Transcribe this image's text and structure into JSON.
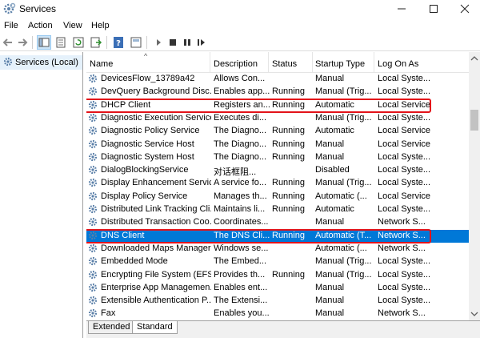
{
  "window": {
    "title": "Services",
    "icon": "gear-icon",
    "controls": [
      "minimize-icon",
      "maximize-icon",
      "close-icon"
    ]
  },
  "menu": [
    {
      "label": "File",
      "accel": "F"
    },
    {
      "label": "Action",
      "accel": "A"
    },
    {
      "label": "View",
      "accel": "V"
    },
    {
      "label": "Help",
      "accel": "H"
    }
  ],
  "toolbar": {
    "icons": [
      "back-icon",
      "forward-icon",
      "console-tree-icon",
      "properties-icon",
      "refresh-icon",
      "export-icon",
      "help-icon",
      "show-hide-icon",
      "start-icon",
      "stop-icon",
      "pause-icon",
      "restart-icon"
    ]
  },
  "tree": {
    "root_label": "Services (Local)"
  },
  "table": {
    "columns": [
      "Name",
      "Description",
      "Status",
      "Startup Type",
      "Log On As"
    ],
    "sorted_column": "Name",
    "rows": [
      {
        "name": "DevicesFlow_13789a42",
        "description": "Allows Con...",
        "status": "",
        "startup": "Manual",
        "logon": "Local Syste..."
      },
      {
        "name": "DevQuery Background Disc...",
        "description": "Enables app...",
        "status": "Running",
        "startup": "Manual (Trig...",
        "logon": "Local Syste..."
      },
      {
        "name": "DHCP Client",
        "description": "Registers an...",
        "status": "Running",
        "startup": "Automatic",
        "logon": "Local Service"
      },
      {
        "name": "Diagnostic Execution Service",
        "description": "Executes di...",
        "status": "",
        "startup": "Manual (Trig...",
        "logon": "Local Syste..."
      },
      {
        "name": "Diagnostic Policy Service",
        "description": "The Diagno...",
        "status": "Running",
        "startup": "Automatic",
        "logon": "Local Service"
      },
      {
        "name": "Diagnostic Service Host",
        "description": "The Diagno...",
        "status": "Running",
        "startup": "Manual",
        "logon": "Local Service"
      },
      {
        "name": "Diagnostic System Host",
        "description": "The Diagno...",
        "status": "Running",
        "startup": "Manual",
        "logon": "Local Syste..."
      },
      {
        "name": "DialogBlockingService",
        "description": "对话框阻...",
        "status": "",
        "startup": "Disabled",
        "logon": "Local Syste..."
      },
      {
        "name": "Display Enhancement Service",
        "description": "A service fo...",
        "status": "Running",
        "startup": "Manual (Trig...",
        "logon": "Local Syste..."
      },
      {
        "name": "Display Policy Service",
        "description": "Manages th...",
        "status": "Running",
        "startup": "Automatic (...",
        "logon": "Local Service"
      },
      {
        "name": "Distributed Link Tracking Cli...",
        "description": "Maintains li...",
        "status": "Running",
        "startup": "Automatic",
        "logon": "Local Syste..."
      },
      {
        "name": "Distributed Transaction Coo...",
        "description": "Coordinates...",
        "status": "",
        "startup": "Manual",
        "logon": "Network S..."
      },
      {
        "name": "DNS Client",
        "description": "The DNS Cli...",
        "status": "Running",
        "startup": "Automatic (T...",
        "logon": "Network S..."
      },
      {
        "name": "Downloaded Maps Manager",
        "description": "Windows se...",
        "status": "",
        "startup": "Automatic (...",
        "logon": "Network S..."
      },
      {
        "name": "Embedded Mode",
        "description": "The Embed...",
        "status": "",
        "startup": "Manual (Trig...",
        "logon": "Local Syste..."
      },
      {
        "name": "Encrypting File System (EFS)",
        "description": "Provides th...",
        "status": "Running",
        "startup": "Manual (Trig...",
        "logon": "Local Syste..."
      },
      {
        "name": "Enterprise App Managemen...",
        "description": "Enables ent...",
        "status": "",
        "startup": "Manual",
        "logon": "Local Syste..."
      },
      {
        "name": "Extensible Authentication P...",
        "description": "The Extensi...",
        "status": "",
        "startup": "Manual",
        "logon": "Local Syste..."
      },
      {
        "name": "Fax",
        "description": "Enables you...",
        "status": "",
        "startup": "Manual",
        "logon": "Network S..."
      }
    ],
    "selected_row": "DNS Client",
    "highlighted_rows": [
      "DHCP Client",
      "DNS Client"
    ]
  },
  "tabs": [
    {
      "label": "Extended"
    },
    {
      "label": "Standard",
      "active": true
    }
  ],
  "colors": {
    "selection": "#0078d7",
    "highlight_box": "#e3131a"
  }
}
